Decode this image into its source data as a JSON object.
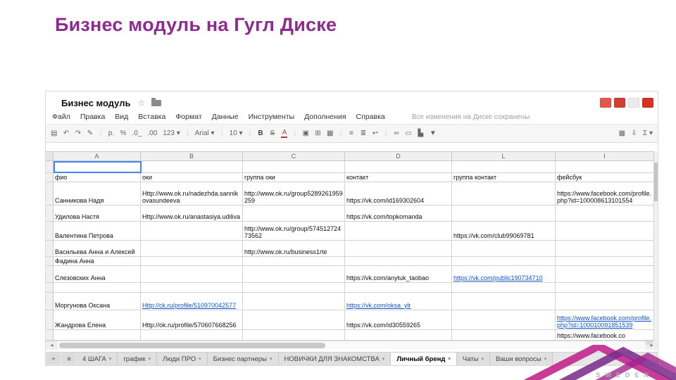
{
  "slide": {
    "title": "Бизнес модуль на Гугл Диске",
    "brand": "SWEDEN",
    "watermark_fragment": "па"
  },
  "sheet": {
    "doc_title": "Бизнес модуль",
    "star_icon": "☆",
    "save_status": "Все изменения на Диске сохранены",
    "menu": [
      "Файл",
      "Правка",
      "Вид",
      "Вставка",
      "Формат",
      "Данные",
      "Инструменты",
      "Дополнения",
      "Справка"
    ],
    "top_icons": [
      {
        "name": "browser-icon-1",
        "color": "#e2574c"
      },
      {
        "name": "browser-icon-2",
        "color": "#d23f31"
      },
      {
        "name": "browser-icon-3",
        "color": "#ececec"
      },
      {
        "name": "browser-icon-4",
        "color": "#d93025"
      }
    ],
    "toolbar": [
      {
        "name": "print-icon",
        "glyph": "▤"
      },
      {
        "name": "undo-icon",
        "glyph": "↶"
      },
      {
        "name": "redo-icon",
        "glyph": "↷"
      },
      {
        "name": "paint-format-icon",
        "glyph": "✎"
      },
      {
        "name": "divider-1",
        "glyph": "|",
        "cls": "sep"
      },
      {
        "name": "currency-format-button",
        "glyph": "р."
      },
      {
        "name": "percent-format-button",
        "glyph": "%"
      },
      {
        "name": "decimal-decrease-button",
        "glyph": ".0_"
      },
      {
        "name": "decimal-increase-button",
        "glyph": ".00"
      },
      {
        "name": "number-format-menu",
        "glyph": "123 ▾"
      },
      {
        "name": "divider-2",
        "glyph": "|",
        "cls": "sep"
      },
      {
        "name": "font-family-select",
        "glyph": "Arial ▾"
      },
      {
        "name": "divider-3",
        "glyph": "|",
        "cls": "sep"
      },
      {
        "name": "font-size-select",
        "glyph": "10 ▾"
      },
      {
        "name": "divider-4",
        "glyph": "|",
        "cls": "sep"
      },
      {
        "name": "bold-button",
        "glyph": "B",
        "cls": "bold"
      },
      {
        "name": "strikethrough-button",
        "glyph": "S",
        "cls": "strike"
      },
      {
        "name": "text-color-button",
        "glyph": "A",
        "cls": "tcolor"
      },
      {
        "name": "divider-5",
        "glyph": "|",
        "cls": "sep"
      },
      {
        "name": "fill-color-button",
        "glyph": "▣"
      },
      {
        "name": "borders-button",
        "glyph": "⊞"
      },
      {
        "name": "merge-cells-button",
        "glyph": "▦"
      },
      {
        "name": "divider-6",
        "glyph": "|",
        "cls": "sep"
      },
      {
        "name": "align-left-button",
        "glyph": "≡"
      },
      {
        "name": "valign-button",
        "glyph": "≣"
      },
      {
        "name": "wrap-text-button",
        "glyph": "↩"
      },
      {
        "name": "divider-7",
        "glyph": "|",
        "cls": "sep"
      },
      {
        "name": "insert-link-button",
        "glyph": "∞"
      },
      {
        "name": "insert-comment-button",
        "glyph": "▭"
      },
      {
        "name": "insert-chart-button",
        "glyph": "▙"
      },
      {
        "name": "filter-button",
        "glyph": "▼"
      },
      {
        "name": "view-grid-button",
        "glyph": "▦",
        "cls": "mla"
      },
      {
        "name": "download-button",
        "glyph": "⇩"
      },
      {
        "name": "functions-button",
        "glyph": "Σ ▾"
      }
    ],
    "columns": [
      "A",
      "B",
      "C",
      "D",
      "L",
      "I"
    ],
    "rows": [
      {
        "cells": [
          {
            "t": ""
          },
          {
            "t": ""
          },
          {
            "t": ""
          },
          {
            "t": ""
          },
          {
            "t": ""
          },
          {
            "t": ""
          }
        ]
      },
      {
        "cells": [
          {
            "t": "фио"
          },
          {
            "t": "оки"
          },
          {
            "t": "группа оки"
          },
          {
            "t": "контакт"
          },
          {
            "t": "группа контакт"
          },
          {
            "t": "фейсбук"
          }
        ]
      },
      {
        "cells": [
          {
            "t": "Санникова Надя"
          },
          {
            "t": "Http://www.ok.ru/nadezhda.sannikovasundeeva"
          },
          {
            "t": "http://www.ok.ru/group5289261959259"
          },
          {
            "t": "https://vk.com/id169302604"
          },
          {
            "t": ""
          },
          {
            "t": "https://www.facebook.com/profile.php?id=100008613101554"
          }
        ]
      },
      {
        "cells": [
          {
            "t": "Удилова Настя"
          },
          {
            "t": "Http://www.ok.ru/anastasiya.udiliva"
          },
          {
            "t": ""
          },
          {
            "t": "https://vk.com/topkomanda"
          },
          {
            "t": ""
          },
          {
            "t": ""
          }
        ]
      },
      {
        "cells": [
          {
            "t": "Валентина Петрова"
          },
          {
            "t": ""
          },
          {
            "t": "http://www.ok.ru/group/57451272473562"
          },
          {
            "t": ""
          },
          {
            "t": "https://vk.com/club99069781"
          },
          {
            "t": ""
          }
        ]
      },
      {
        "cells": [
          {
            "t": "Васильева Анна и Алексей"
          },
          {
            "t": ""
          },
          {
            "t": "http://www.ok.ru/business1rte"
          },
          {
            "t": ""
          },
          {
            "t": ""
          },
          {
            "t": ""
          }
        ]
      },
      {
        "cells": [
          {
            "t": "Фадина Анна"
          },
          {
            "t": ""
          },
          {
            "t": ""
          },
          {
            "t": ""
          },
          {
            "t": ""
          },
          {
            "t": ""
          }
        ]
      },
      {
        "cells": [
          {
            "t": "Слезовских Анна"
          },
          {
            "t": ""
          },
          {
            "t": ""
          },
          {
            "t": "https://vk.com/anytuk_taobao"
          },
          {
            "t": "https://vk.com/public190734710",
            "link": true
          },
          {
            "t": ""
          }
        ]
      },
      {
        "cells": [
          {
            "t": ""
          },
          {
            "t": ""
          },
          {
            "t": ""
          },
          {
            "t": ""
          },
          {
            "t": ""
          },
          {
            "t": ""
          }
        ]
      },
      {
        "cells": [
          {
            "t": "Моргунова Оксана"
          },
          {
            "t": "Http://ck.ru/profile/510970042577",
            "link": true
          },
          {
            "t": ""
          },
          {
            "t": "https://vk.com/oksa_ylr",
            "link": true
          },
          {
            "t": ""
          },
          {
            "t": ""
          }
        ]
      },
      {
        "cells": [
          {
            "t": "Жандрова Елена"
          },
          {
            "t": "Http://ok.ru/profile/570607668256"
          },
          {
            "t": ""
          },
          {
            "t": "https://vk.com/id30559265"
          },
          {
            "t": ""
          },
          {
            "t": "https://www.facebook.com/profile.php?id=100010091851539",
            "link": true
          }
        ]
      },
      {
        "cells": [
          {
            "t": ""
          },
          {
            "t": ""
          },
          {
            "t": ""
          },
          {
            "t": ""
          },
          {
            "t": ""
          },
          {
            "t": "https://www.facebook.co"
          }
        ]
      }
    ],
    "scrollbar": {
      "left_arrow": "◂",
      "right_arrow": "▸"
    },
    "tab_controls": {
      "add": "+",
      "all": "≡"
    },
    "tabs": [
      {
        "label": "4 ШАГА"
      },
      {
        "label": "график"
      },
      {
        "label": "Люди ПРО"
      },
      {
        "label": "Бизнес партнеры"
      },
      {
        "label": "НОВИЧКИ ДЛЯ ЗНАКОМСТВА"
      },
      {
        "label": "Личный бренд",
        "active": true
      },
      {
        "label": "Чаты"
      },
      {
        "label": "Ваши вопросы"
      }
    ]
  }
}
